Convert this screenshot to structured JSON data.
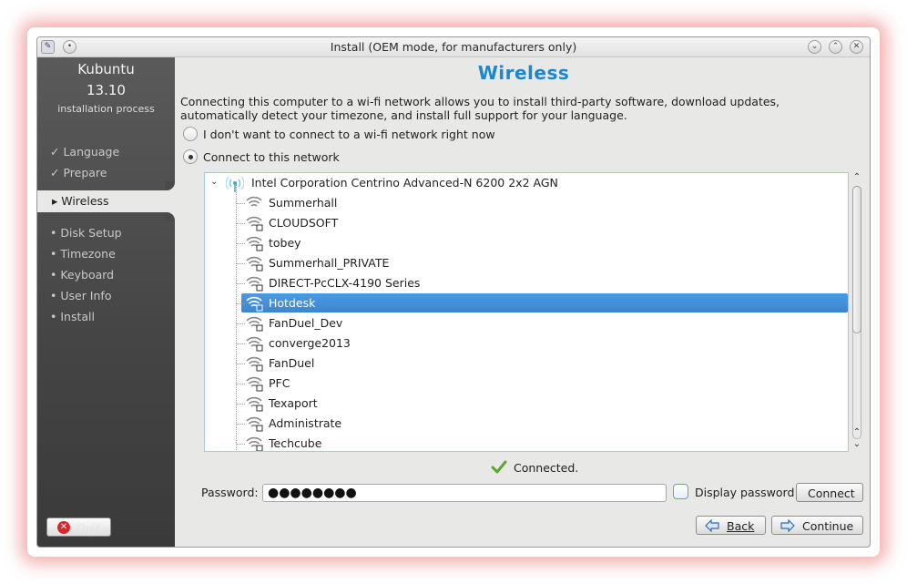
{
  "window": {
    "title": "Install (OEM mode, for manufacturers only)"
  },
  "sidebar": {
    "brand": "Kubuntu",
    "version": "13.10",
    "subtitle": "installation process",
    "items": [
      {
        "label": "✓ Language",
        "state": "done"
      },
      {
        "label": "✓ Prepare",
        "state": "done"
      },
      {
        "label": "▸ Wireless",
        "state": "active"
      },
      {
        "label": "• Disk Setup",
        "state": "pending"
      },
      {
        "label": "• Timezone",
        "state": "pending"
      },
      {
        "label": "• Keyboard",
        "state": "pending"
      },
      {
        "label": "• User Info",
        "state": "pending"
      },
      {
        "label": "• Install",
        "state": "pending"
      }
    ],
    "quit_label": "Quit"
  },
  "main": {
    "title": "Wireless",
    "description": "Connecting this computer to a wi-fi network allows you to install third-party software, download updates, automatically detect your timezone, and install full support for your language.",
    "option_no_wifi": "I don't want to connect to a wi-fi network right now",
    "option_connect": "Connect to this network",
    "selected_option": "connect"
  },
  "networks": {
    "device": "Intel Corporation Centrino Advanced-N 6200 2x2 AGN",
    "list": [
      {
        "ssid": "Summerhall",
        "secured": false,
        "selected": false
      },
      {
        "ssid": "CLOUDSOFT",
        "secured": true,
        "selected": false
      },
      {
        "ssid": "tobey",
        "secured": true,
        "selected": false
      },
      {
        "ssid": "Summerhall_PRIVATE",
        "secured": true,
        "selected": false
      },
      {
        "ssid": "DIRECT-PcCLX-4190 Series",
        "secured": true,
        "selected": false
      },
      {
        "ssid": "Hotdesk",
        "secured": true,
        "selected": true
      },
      {
        "ssid": "FanDuel_Dev",
        "secured": true,
        "selected": false
      },
      {
        "ssid": "converge2013",
        "secured": true,
        "selected": false
      },
      {
        "ssid": "FanDuel",
        "secured": true,
        "selected": false
      },
      {
        "ssid": "PFC",
        "secured": true,
        "selected": false
      },
      {
        "ssid": "Texaport",
        "secured": true,
        "selected": false
      },
      {
        "ssid": "Administrate",
        "secured": true,
        "selected": false
      },
      {
        "ssid": "Techcube",
        "secured": true,
        "selected": false
      }
    ]
  },
  "status": {
    "text": "Connected.",
    "icon": "check-icon"
  },
  "password": {
    "label": "Password:",
    "value": "●●●●●●●●",
    "show_label": "Display password",
    "connect_label": "Connect"
  },
  "footer": {
    "back_label": "Back",
    "continue_label": "Continue"
  },
  "colors": {
    "accent": "#1d87c8",
    "selection": "#3a86d2",
    "sidebar": "#4a4a4a"
  }
}
